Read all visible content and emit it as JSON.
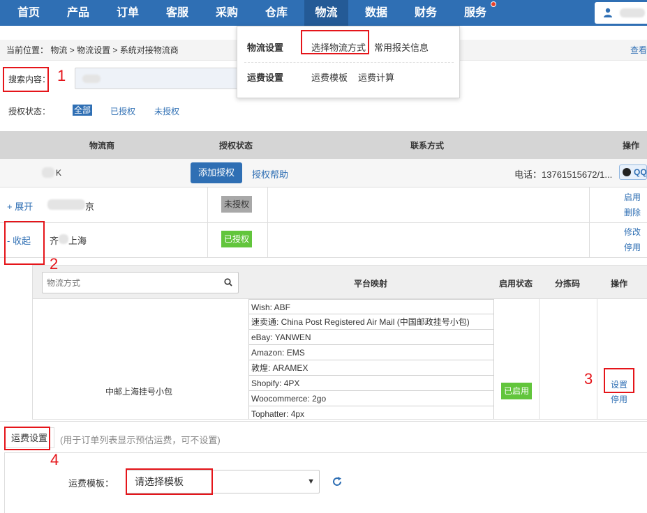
{
  "nav": {
    "items": [
      "首页",
      "产品",
      "订单",
      "客服",
      "采购",
      "仓库",
      "物流",
      "数据",
      "财务",
      "服务"
    ],
    "active": "物流"
  },
  "dropdown": {
    "logistics_settings": "物流设置",
    "select_method": "选择物流方式",
    "customs_info": "常用报关信息",
    "freight_settings": "运费设置",
    "freight_template": "运费模板",
    "freight_calc": "运费计算"
  },
  "breadcrumb": {
    "prefix": "当前位置：",
    "path": [
      "物流",
      "物流设置",
      "系统对接物流商"
    ],
    "right_link": "查看"
  },
  "search": {
    "label": "搜索内容："
  },
  "filter": {
    "label": "授权状态：",
    "options": [
      "全部",
      "已授权",
      "未授权"
    ],
    "selected": "全部"
  },
  "table": {
    "headers": [
      "物流商",
      "授权状态",
      "联系方式",
      "操作"
    ],
    "provider": {
      "name_suffix": "K",
      "add_auth": "添加授权",
      "auth_help": "授权帮助",
      "phone": "电话：13761515672/1...",
      "qq": "QQ"
    },
    "rows": [
      {
        "toggle": "+ 展开",
        "name_suffix": "京",
        "status": "未授权",
        "actions": [
          "启用",
          "删除"
        ]
      },
      {
        "toggle": "- 收起",
        "name_prefix": "齐",
        "name_suffix": "上海",
        "status": "已授权",
        "actions": [
          "修改",
          "停用"
        ]
      }
    ]
  },
  "subtable": {
    "search_placeholder": "物流方式",
    "headers": [
      "平台映射",
      "启用状态",
      "分拣码",
      "操作"
    ],
    "method": "中邮上海挂号小包",
    "mappings": [
      "Wish:  ABF",
      "速卖通:  China Post Registered Air Mail (中国邮政挂号小包)",
      "eBay:  YANWEN",
      "Amazon:  EMS",
      "敦煌:  ARAMEX",
      "Shopify:  4PX",
      "Woocommerce:  2go",
      "Tophatter:  4px"
    ],
    "status": "已启用",
    "actions": [
      "设置",
      "停用"
    ]
  },
  "freight": {
    "tab": "运费设置",
    "hint": "(用于订单列表显示预估运费，可不设置)",
    "template_label": "运费模板：",
    "template_value": "请选择模板"
  },
  "annotations": [
    "1",
    "2",
    "3",
    "4"
  ],
  "colors": {
    "nav_bg": "#2f6fb4",
    "nav_active": "#245a96",
    "annotation": "#e5151a",
    "enabled_green": "#62c53c"
  }
}
